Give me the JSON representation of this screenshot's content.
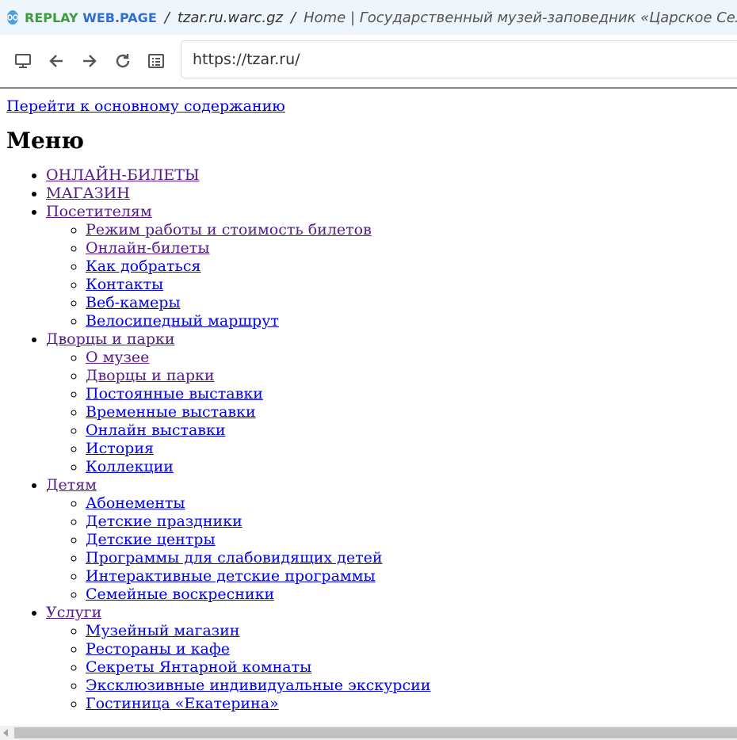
{
  "app": {
    "brand_part1": "REPLAY ",
    "brand_part2": "WEB.PAGE",
    "separator": "/",
    "archive_file": "tzar.ru.warc.gz",
    "page_title": "Home | Государственный музей-заповедник «Царское Село»"
  },
  "toolbar": {
    "url": "https://tzar.ru/",
    "icons": [
      "monitor-icon",
      "back-arrow-icon",
      "forward-arrow-icon",
      "reload-icon",
      "page-list-icon"
    ]
  },
  "page": {
    "skip_link": "Перейти к основному содержанию",
    "menu_heading": "Меню",
    "menu": [
      {
        "label": "ОНЛАЙН-БИЛЕТЫ",
        "visited": true,
        "children": []
      },
      {
        "label": "МАГАЗИН",
        "visited": true,
        "children": []
      },
      {
        "label": "Посетителям",
        "visited": true,
        "children": [
          {
            "label": "Режим работы и стоимость билетов",
            "visited": true
          },
          {
            "label": "Онлайн-билеты",
            "visited": true
          },
          {
            "label": "Как добраться",
            "visited": false
          },
          {
            "label": "Контакты",
            "visited": false
          },
          {
            "label": "Веб-камеры",
            "visited": false
          },
          {
            "label": "Велосипедный маршрут",
            "visited": false
          }
        ]
      },
      {
        "label": "Дворцы и парки",
        "visited": true,
        "children": [
          {
            "label": "О музее",
            "visited": true
          },
          {
            "label": "Дворцы и парки",
            "visited": true
          },
          {
            "label": "Постоянные выставки",
            "visited": false
          },
          {
            "label": "Временные выставки",
            "visited": false
          },
          {
            "label": "Онлайн выставки",
            "visited": false
          },
          {
            "label": "История",
            "visited": false
          },
          {
            "label": "Коллекции",
            "visited": false
          }
        ]
      },
      {
        "label": "Детям",
        "visited": true,
        "children": [
          {
            "label": "Абонементы",
            "visited": false
          },
          {
            "label": "Детские праздники",
            "visited": false
          },
          {
            "label": "Детские центры",
            "visited": false
          },
          {
            "label": "Программы для слабовидящих детей",
            "visited": false
          },
          {
            "label": "Интерактивные детские программы",
            "visited": false
          },
          {
            "label": "Семейные воскресники",
            "visited": false
          }
        ]
      },
      {
        "label": "Услуги",
        "visited": true,
        "children": [
          {
            "label": "Музейный магазин",
            "visited": false
          },
          {
            "label": "Рестораны и кафе",
            "visited": false
          },
          {
            "label": "Секреты Янтарной комнаты ",
            "visited": false
          },
          {
            "label": "Эксклюзивные индивидуальные экскурсии",
            "visited": false
          },
          {
            "label": "Гостиница «Екатерина»",
            "visited": false
          }
        ]
      }
    ]
  },
  "colors": {
    "link": "#0000ee",
    "visited_link": "#551a8b",
    "topbar_bg": "#eef5fb",
    "brand_green": "#3c9d3c",
    "brand_blue": "#2f6fd1"
  }
}
